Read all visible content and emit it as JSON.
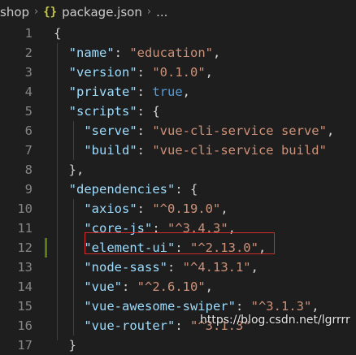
{
  "breadcrumb": {
    "folder": "shop",
    "file_icon": "{}",
    "file": "package.json",
    "ellipsis": "..."
  },
  "colors": {
    "background": "#1e1e1e",
    "key": "#9cdcfe",
    "string": "#ce9178",
    "keyword": "#569cd6",
    "highlight_box": "#d12b2b",
    "git_modified": "#587c0c"
  },
  "lines": [
    {
      "num": "1",
      "indent": "",
      "key": "",
      "sep": "",
      "value": "",
      "value_type": "",
      "tail": "{"
    },
    {
      "num": "2",
      "indent": "  ",
      "key": "\"name\"",
      "sep": ": ",
      "value": "\"education\"",
      "value_type": "str",
      "tail": ","
    },
    {
      "num": "3",
      "indent": "  ",
      "key": "\"version\"",
      "sep": ": ",
      "value": "\"0.1.0\"",
      "value_type": "str",
      "tail": ","
    },
    {
      "num": "4",
      "indent": "  ",
      "key": "\"private\"",
      "sep": ": ",
      "value": "true",
      "value_type": "kw",
      "tail": ","
    },
    {
      "num": "5",
      "indent": "  ",
      "key": "\"scripts\"",
      "sep": ": ",
      "value": "",
      "value_type": "",
      "tail": "{"
    },
    {
      "num": "6",
      "indent": "    ",
      "key": "\"serve\"",
      "sep": ": ",
      "value": "\"vue-cli-service serve\"",
      "value_type": "str",
      "tail": ","
    },
    {
      "num": "7",
      "indent": "    ",
      "key": "\"build\"",
      "sep": ": ",
      "value": "\"vue-cli-service build\"",
      "value_type": "str",
      "tail": ""
    },
    {
      "num": "8",
      "indent": "  ",
      "key": "",
      "sep": "",
      "value": "",
      "value_type": "",
      "tail": "},"
    },
    {
      "num": "9",
      "indent": "  ",
      "key": "\"dependencies\"",
      "sep": ": ",
      "value": "",
      "value_type": "",
      "tail": "{"
    },
    {
      "num": "10",
      "indent": "    ",
      "key": "\"axios\"",
      "sep": ": ",
      "value": "\"^0.19.0\"",
      "value_type": "str",
      "tail": ","
    },
    {
      "num": "11",
      "indent": "    ",
      "key": "\"core-js\"",
      "sep": ": ",
      "value": "\"^3.4.3\"",
      "value_type": "str",
      "tail": ","
    },
    {
      "num": "12",
      "indent": "    ",
      "key": "\"element-ui\"",
      "sep": ": ",
      "value": "\"^2.13.0\"",
      "value_type": "str",
      "tail": ","
    },
    {
      "num": "13",
      "indent": "    ",
      "key": "\"node-sass\"",
      "sep": ": ",
      "value": "\"^4.13.1\"",
      "value_type": "str",
      "tail": ","
    },
    {
      "num": "14",
      "indent": "    ",
      "key": "\"vue\"",
      "sep": ": ",
      "value": "\"^2.6.10\"",
      "value_type": "str",
      "tail": ","
    },
    {
      "num": "15",
      "indent": "    ",
      "key": "\"vue-awesome-swiper\"",
      "sep": ": ",
      "value": "\"^3.1.3\"",
      "value_type": "str",
      "tail": ","
    },
    {
      "num": "16",
      "indent": "    ",
      "key": "\"vue-router\"",
      "sep": ": ",
      "value": "\"^3.1.3\"",
      "value_type": "str",
      "tail": ""
    },
    {
      "num": "17",
      "indent": "  ",
      "key": "",
      "sep": "",
      "value": "",
      "value_type": "",
      "tail": "}"
    }
  ],
  "watermark": "https://blog.csdn.net/lgrrrr"
}
